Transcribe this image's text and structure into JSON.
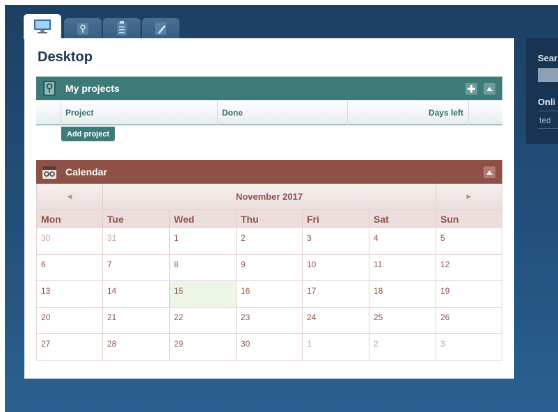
{
  "tabs": [
    {
      "icon": "monitor-icon",
      "active": true
    },
    {
      "icon": "projects-icon",
      "active": false
    },
    {
      "icon": "clipboard-icon",
      "active": false
    },
    {
      "icon": "notepad-icon",
      "active": false
    }
  ],
  "page": {
    "title": "Desktop"
  },
  "projects": {
    "title": "My projects",
    "icon": "projects-icon",
    "columns": [
      "Project",
      "Done",
      "Days left"
    ],
    "add_label": "Add project"
  },
  "calendar": {
    "title": "Calendar",
    "icon": "calendar-icon",
    "month": "November 2017",
    "prev": "◀",
    "next": "▶",
    "weekdays": [
      "Mon",
      "Tue",
      "Wed",
      "Thu",
      "Fri",
      "Sat",
      "Sun"
    ],
    "weeks": [
      [
        "30",
        "31",
        "1",
        "2",
        "3",
        "4",
        "5"
      ],
      [
        "6",
        "7",
        "8",
        "9",
        "10",
        "11",
        "12"
      ],
      [
        "13",
        "14",
        "15",
        "16",
        "17",
        "18",
        "19"
      ],
      [
        "20",
        "21",
        "22",
        "23",
        "24",
        "25",
        "26"
      ],
      [
        "27",
        "28",
        "29",
        "30",
        "1",
        "2",
        "3"
      ]
    ],
    "muted": [
      [
        0,
        0
      ],
      [
        0,
        1
      ],
      [
        4,
        4
      ],
      [
        4,
        5
      ],
      [
        4,
        6
      ]
    ],
    "today": [
      2,
      2
    ]
  },
  "side": {
    "search_label": "Sear",
    "online_label": "Onli",
    "online_user": "ted"
  },
  "colors": {
    "projects_accent": "#3f7a7a",
    "calendar_accent": "#8e5148",
    "today_bg": "#ecf5e6"
  }
}
